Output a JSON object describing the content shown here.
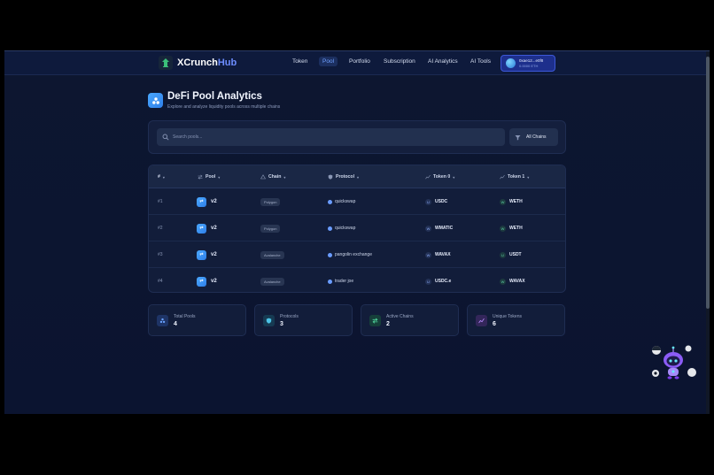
{
  "nav": {
    "logo_part1": "XCrunch",
    "logo_part2": "Hub",
    "links": [
      {
        "label": "Token"
      },
      {
        "label": "Pool"
      },
      {
        "label": "Portfolio"
      },
      {
        "label": "Subscription"
      },
      {
        "label": "AI Analytics"
      },
      {
        "label": "AI Tools"
      }
    ],
    "wallet": {
      "name": "0xae12...e0f8",
      "balance": "0.0000 ETH"
    }
  },
  "header": {
    "title": "DeFi Pool Analytics",
    "subtitle": "Explore and analyze liquidity pools across multiple chains"
  },
  "search": {
    "placeholder": "Search pools...",
    "chains_label": "All Chains"
  },
  "table": {
    "columns": [
      {
        "label": "#"
      },
      {
        "label": "Pool"
      },
      {
        "label": "Chain"
      },
      {
        "label": "Protocol"
      },
      {
        "label": "Token 0"
      },
      {
        "label": "Token 1"
      }
    ],
    "rows": [
      {
        "rank": "#1",
        "pool": "v2",
        "chain": "Polygon",
        "protocol": "quickswap",
        "token0": "USDC",
        "token0_icon": "U",
        "token1": "WETH",
        "token1_icon": "W"
      },
      {
        "rank": "#2",
        "pool": "v2",
        "chain": "Polygon",
        "protocol": "quickswap",
        "token0": "WMATIC",
        "token0_icon": "W",
        "token1": "WETH",
        "token1_icon": "W"
      },
      {
        "rank": "#3",
        "pool": "v2",
        "chain": "Avalanche",
        "protocol": "pangolin exchange",
        "token0": "WAVAX",
        "token0_icon": "W",
        "token1": "USDT",
        "token1_icon": "U"
      },
      {
        "rank": "#4",
        "pool": "v2",
        "chain": "Avalanche",
        "protocol": "trader joe",
        "token0": "USDC.e",
        "token0_icon": "U",
        "token1": "WAVAX",
        "token1_icon": "W"
      }
    ]
  },
  "stats": [
    {
      "label": "Total Pools",
      "value": "4",
      "color": "#2f6fe0"
    },
    {
      "label": "Protocols",
      "value": "3",
      "color": "#1f8fb0"
    },
    {
      "label": "Active Chains",
      "value": "2",
      "color": "#1f9c6a"
    },
    {
      "label": "Unique Tokens",
      "value": "6",
      "color": "#8a4fd6"
    }
  ]
}
